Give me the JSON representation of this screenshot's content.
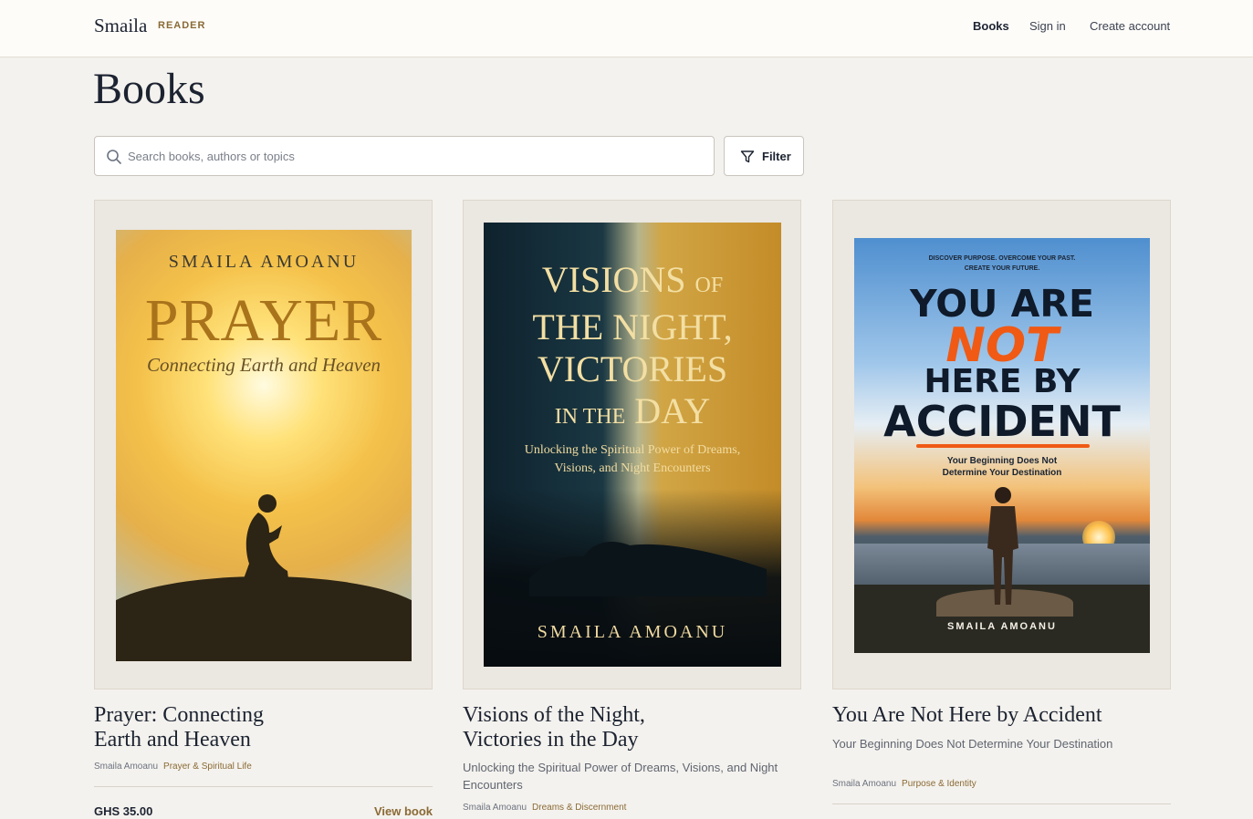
{
  "header": {
    "brand": "Smaila",
    "brand_tag": "READER",
    "nav": [
      {
        "label": "Books"
      },
      {
        "label": "Sign in"
      },
      {
        "label": "Create account"
      }
    ]
  },
  "page": {
    "title": "Books"
  },
  "search": {
    "placeholder": "Search books, authors or topics",
    "value": ""
  },
  "filter": {
    "label": "Filter"
  },
  "books": [
    {
      "title_lines": [
        "Prayer: Connecting",
        "Earth and Heaven"
      ],
      "subtitle": "",
      "author": "Smaila Amoanu",
      "category": "Prayer & Spiritual Life",
      "price": "GHS 35.00",
      "action": "View book",
      "cover": {
        "author": "SMAILA AMOANU",
        "title": "PRAYER",
        "subtitle": "Connecting Earth and Heaven"
      }
    },
    {
      "title_lines": [
        "Visions of the Night,",
        "Victories in the Day"
      ],
      "subtitle": "Unlocking the Spiritual Power of Dreams, Visions, and Night Encounters",
      "author": "Smaila Amoanu",
      "category": "Dreams & Discernment",
      "cover": {
        "line1_big": "VISIONS",
        "line1_small": "OF",
        "line2": "THE NIGHT,",
        "line3": "VICTORIES",
        "line4_small": "IN THE",
        "line4_big": "DAY",
        "subtitle": "Unlocking the Spiritual Power of Dreams, Visions, and Night Encounters",
        "author": "SMAILA AMOANU"
      }
    },
    {
      "title_lines": [
        "You Are Not Here by Accident"
      ],
      "subtitle": "Your Beginning Does Not Determine Your Destination",
      "author": "Smaila Amoanu",
      "category": "Purpose & Identity",
      "cover": {
        "kicker1": "DISCOVER PURPOSE.  OVERCOME YOUR PAST.",
        "kicker2": "CREATE YOUR FUTURE.",
        "line1": "YOU ARE",
        "line2": "NOT",
        "line3": "HERE BY",
        "line4": "ACCIDENT",
        "tagline1": "Your Beginning Does Not",
        "tagline2": "Determine Your Destination",
        "author": "SMAILA AMOANU"
      }
    }
  ],
  "colors": {
    "background": "#f4f2ee",
    "accent": "#8a6a35",
    "text": "#1c2331"
  }
}
